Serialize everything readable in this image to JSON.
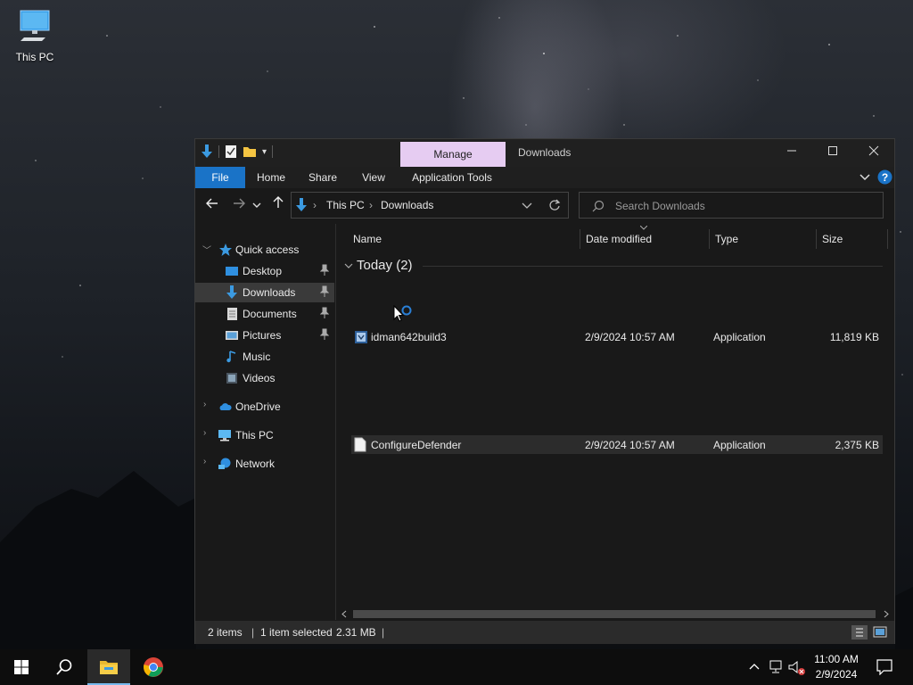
{
  "desktop": {
    "icons": [
      {
        "label": "This PC",
        "icon": "monitor-icon"
      }
    ]
  },
  "window": {
    "title": "Downloads",
    "contextual_tab": "Manage",
    "contextual_tab_color": "#e6ccf2",
    "ribbon_tabs": [
      "File",
      "Home",
      "Share",
      "View",
      "Application Tools"
    ],
    "file_tab_color": "#1a73c7",
    "controls": {
      "minimize": "minimize-icon",
      "maximize": "maximize-icon",
      "close": "close-icon"
    }
  },
  "address": {
    "breadcrumbs": [
      "This PC",
      "Downloads"
    ]
  },
  "search": {
    "placeholder": "Search Downloads"
  },
  "nav_pane": {
    "quick_access": "Quick access",
    "quick_items": [
      {
        "label": "Desktop",
        "icon": "desktop-folder-icon",
        "pinned": true
      },
      {
        "label": "Downloads",
        "icon": "downloads-folder-icon",
        "pinned": true,
        "selected": true
      },
      {
        "label": "Documents",
        "icon": "documents-folder-icon",
        "pinned": true
      },
      {
        "label": "Pictures",
        "icon": "pictures-folder-icon",
        "pinned": true
      },
      {
        "label": "Music",
        "icon": "music-icon",
        "pinned": false
      },
      {
        "label": "Videos",
        "icon": "videos-icon",
        "pinned": false
      }
    ],
    "roots": [
      {
        "label": "OneDrive",
        "icon": "cloud-icon"
      },
      {
        "label": "This PC",
        "icon": "monitor-icon"
      },
      {
        "label": "Network",
        "icon": "network-icon"
      }
    ]
  },
  "file_list": {
    "columns": [
      "Name",
      "Date modified",
      "Type",
      "Size"
    ],
    "group": "Today (2)",
    "rows": [
      {
        "name": "idman642build3",
        "date": "2/9/2024 10:57 AM",
        "type": "Application",
        "size": "11,819 KB",
        "icon": "installer-icon",
        "selected": false
      },
      {
        "name": "ConfigureDefender",
        "date": "2/9/2024 10:57 AM",
        "type": "Application",
        "size": "2,375 KB",
        "icon": "file-icon",
        "selected": true
      }
    ]
  },
  "status_bar": {
    "items": "2 items",
    "selection": "1 item selected",
    "selection_size": "2.31 MB"
  },
  "taskbar": {
    "time": "11:00 AM",
    "date": "2/9/2024",
    "accent": "#76b9ed"
  }
}
